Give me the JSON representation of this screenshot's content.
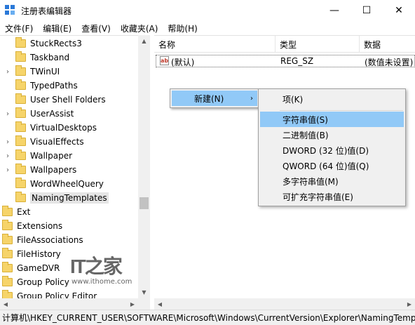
{
  "window": {
    "title": "注册表编辑器",
    "minimize": "—",
    "maximize": "☐",
    "close": "✕"
  },
  "menubar": [
    "文件(F)",
    "编辑(E)",
    "查看(V)",
    "收藏夹(A)",
    "帮助(H)"
  ],
  "tree": {
    "items": [
      {
        "label": "StuckRects3",
        "expandable": false
      },
      {
        "label": "Taskband",
        "expandable": false
      },
      {
        "label": "TWinUI",
        "expandable": true
      },
      {
        "label": "TypedPaths",
        "expandable": false
      },
      {
        "label": "User Shell Folders",
        "expandable": false
      },
      {
        "label": "UserAssist",
        "expandable": true
      },
      {
        "label": "VirtualDesktops",
        "expandable": false
      },
      {
        "label": "VisualEffects",
        "expandable": true
      },
      {
        "label": "Wallpaper",
        "expandable": true
      },
      {
        "label": "Wallpapers",
        "expandable": true
      },
      {
        "label": "WordWheelQuery",
        "expandable": false
      },
      {
        "label": "NamingTemplates",
        "expandable": false,
        "selected": true
      },
      {
        "label": "Ext",
        "expandable": false
      },
      {
        "label": "Extensions",
        "expandable": false
      },
      {
        "label": "FileAssociations",
        "expandable": false
      },
      {
        "label": "FileHistory",
        "expandable": false
      },
      {
        "label": "GameDVR",
        "expandable": false
      },
      {
        "label": "Group Policy",
        "expandable": false
      },
      {
        "label": "Group Policy Editor",
        "expandable": false
      }
    ]
  },
  "list": {
    "columns": [
      "名称",
      "类型",
      "数据"
    ],
    "rows": [
      {
        "name": "(默认)",
        "type": "REG_SZ",
        "data": "(数值未设置)"
      }
    ]
  },
  "context_menu": {
    "new_label": "新建(N)",
    "submenu_arrow": "›",
    "submenu": [
      "项(K)",
      "字符串值(S)",
      "二进制值(B)",
      "DWORD (32 位)值(D)",
      "QWORD (64 位)值(Q)",
      "多字符串值(M)",
      "可扩充字符串值(E)"
    ],
    "highlighted_index": 1
  },
  "statusbar": {
    "path": "计算机\\HKEY_CURRENT_USER\\SOFTWARE\\Microsoft\\Windows\\CurrentVersion\\Explorer\\NamingTemplates"
  },
  "watermark": {
    "logo": "IT之家",
    "url": "www.ithome.com"
  },
  "colors": {
    "highlight": "#91c9f7",
    "folder": "#f6d46a",
    "menu_bg": "#f0f0f0"
  }
}
